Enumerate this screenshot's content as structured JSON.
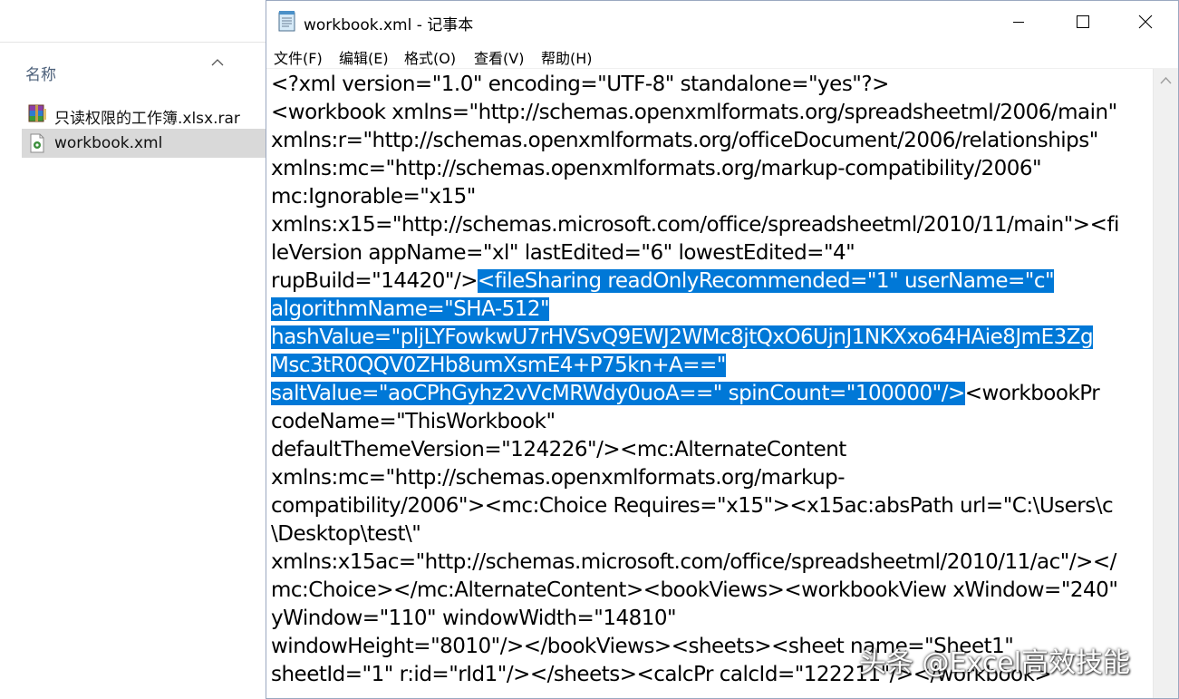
{
  "explorer": {
    "column_name": "名称",
    "files": [
      {
        "name": "只读权限的工作簿.xlsx.rar",
        "icon": "rar-archive-icon",
        "selected": false
      },
      {
        "name": "workbook.xml",
        "icon": "xml-file-icon",
        "selected": true
      }
    ]
  },
  "notepad": {
    "title": "workbook.xml - 记事本",
    "menu": [
      {
        "label": "文件(F)"
      },
      {
        "label": "编辑(E)"
      },
      {
        "label": "格式(O)"
      },
      {
        "label": "查看(V)"
      },
      {
        "label": "帮助(H)"
      }
    ],
    "lines": [
      {
        "pre": "<?xml version=\"1.0\" encoding=\"UTF-8\" standalone=\"yes\"?>",
        "sel": "",
        "post": ""
      },
      {
        "pre": "<workbook xmlns=\"http://schemas.openxmlformats.org/spreadsheetml/2006/main\"",
        "sel": "",
        "post": ""
      },
      {
        "pre": "xmlns:r=\"http://schemas.openxmlformats.org/officeDocument/2006/relationships\"",
        "sel": "",
        "post": ""
      },
      {
        "pre": "xmlns:mc=\"http://schemas.openxmlformats.org/markup-compatibility/2006\"",
        "sel": "",
        "post": ""
      },
      {
        "pre": "mc:Ignorable=\"x15\"",
        "sel": "",
        "post": ""
      },
      {
        "pre": "xmlns:x15=\"http://schemas.microsoft.com/office/spreadsheetml/2010/11/main\"><fi",
        "sel": "",
        "post": ""
      },
      {
        "pre": "leVersion appName=\"xl\" lastEdited=\"6\" lowestEdited=\"4\"",
        "sel": "",
        "post": ""
      },
      {
        "pre": "rupBuild=\"14420\"/>",
        "sel": "<fileSharing readOnlyRecommended=\"1\" userName=\"c\"",
        "post": ""
      },
      {
        "pre": "",
        "sel": "algorithmName=\"SHA-512\"",
        "post": ""
      },
      {
        "pre": "",
        "sel": "hashValue=\"pljLYFowkwU7rHVSvQ9EWJ2WMc8jtQxO6UjnJ1NKXxo64HAie8JmE3Zg",
        "post": ""
      },
      {
        "pre": "",
        "sel": "Msc3tR0QQV0ZHb8umXsmE4+P75kn+A==\"",
        "post": ""
      },
      {
        "pre": "",
        "sel": "saltValue=\"aoCPhGyhz2vVcMRWdy0uoA==\" spinCount=\"100000\"/>",
        "post": "<workbookPr"
      },
      {
        "pre": "codeName=\"ThisWorkbook\"",
        "sel": "",
        "post": ""
      },
      {
        "pre": "defaultThemeVersion=\"124226\"/><mc:AlternateContent",
        "sel": "",
        "post": ""
      },
      {
        "pre": "xmlns:mc=\"http://schemas.openxmlformats.org/markup-",
        "sel": "",
        "post": ""
      },
      {
        "pre": "compatibility/2006\"><mc:Choice Requires=\"x15\"><x15ac:absPath url=\"C:\\Users\\c",
        "sel": "",
        "post": ""
      },
      {
        "pre": "\\Desktop\\test\\\"",
        "sel": "",
        "post": ""
      },
      {
        "pre": "xmlns:x15ac=\"http://schemas.microsoft.com/office/spreadsheetml/2010/11/ac\"/></",
        "sel": "",
        "post": ""
      },
      {
        "pre": "mc:Choice></mc:AlternateContent><bookViews><workbookView xWindow=\"240\"",
        "sel": "",
        "post": ""
      },
      {
        "pre": "yWindow=\"110\" windowWidth=\"14810\"",
        "sel": "",
        "post": ""
      },
      {
        "pre": "windowHeight=\"8010\"/></bookViews><sheets><sheet name=\"Sheet1\"",
        "sel": "",
        "post": ""
      },
      {
        "pre": "sheetId=\"1\" r:id=\"rId1\"/></sheets><calcPr calcId=\"122211\"/></workbook>",
        "sel": "",
        "post": ""
      }
    ],
    "selection_color": "#0078d7"
  },
  "watermark": "头条 @Excel高效技能"
}
